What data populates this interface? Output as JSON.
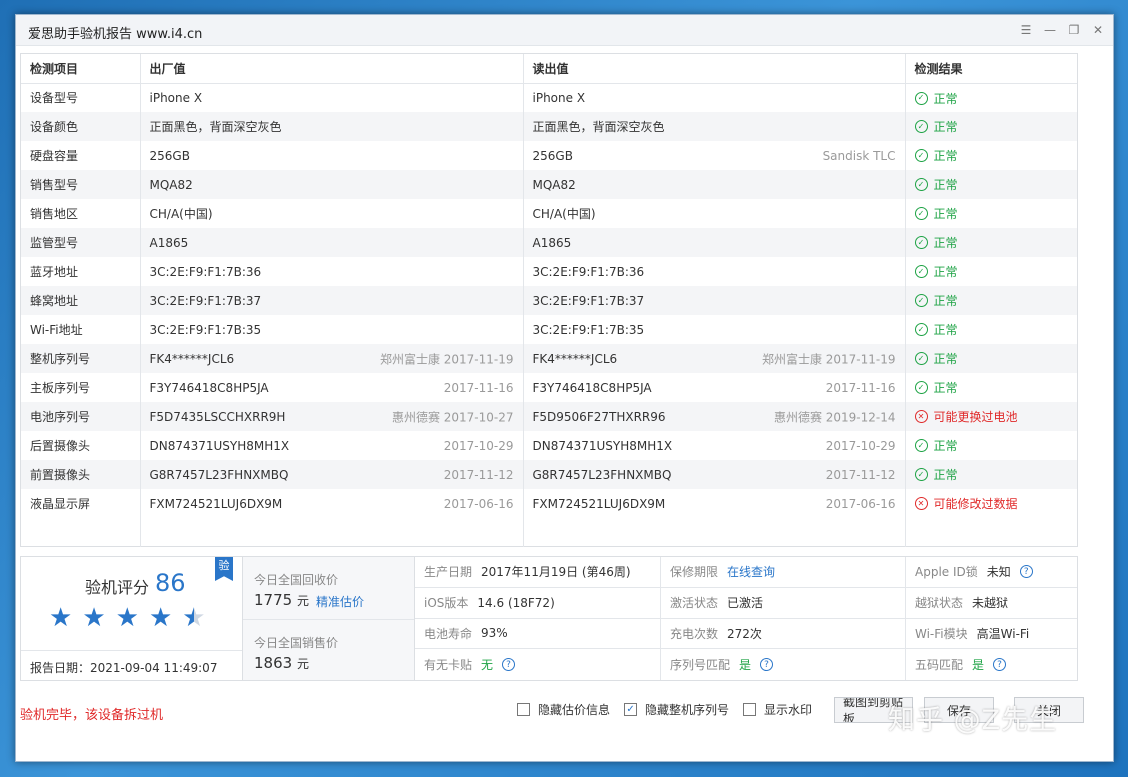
{
  "window": {
    "title": "爱思助手验机报告 www.i4.cn"
  },
  "table": {
    "headers": [
      "检测项目",
      "出厂值",
      "读出值",
      "检测结果"
    ],
    "rows": [
      {
        "item": "设备型号",
        "factory": "iPhone X",
        "factory_extra": "",
        "read": "iPhone X",
        "read_extra": "",
        "result": "正常",
        "ok": true
      },
      {
        "item": "设备颜色",
        "factory": "正面黑色，背面深空灰色",
        "factory_extra": "",
        "read": "正面黑色，背面深空灰色",
        "read_extra": "",
        "result": "正常",
        "ok": true
      },
      {
        "item": "硬盘容量",
        "factory": "256GB",
        "factory_extra": "",
        "read": "256GB",
        "read_extra": "Sandisk TLC",
        "result": "正常",
        "ok": true
      },
      {
        "item": "销售型号",
        "factory": "MQA82",
        "factory_extra": "",
        "read": "MQA82",
        "read_extra": "",
        "result": "正常",
        "ok": true
      },
      {
        "item": "销售地区",
        "factory": "CH/A(中国)",
        "factory_extra": "",
        "read": "CH/A(中国)",
        "read_extra": "",
        "result": "正常",
        "ok": true
      },
      {
        "item": "监管型号",
        "factory": "A1865",
        "factory_extra": "",
        "read": "A1865",
        "read_extra": "",
        "result": "正常",
        "ok": true
      },
      {
        "item": "蓝牙地址",
        "factory": "3C:2E:F9:F1:7B:36",
        "factory_extra": "",
        "read": "3C:2E:F9:F1:7B:36",
        "read_extra": "",
        "result": "正常",
        "ok": true
      },
      {
        "item": "蜂窝地址",
        "factory": "3C:2E:F9:F1:7B:37",
        "factory_extra": "",
        "read": "3C:2E:F9:F1:7B:37",
        "read_extra": "",
        "result": "正常",
        "ok": true
      },
      {
        "item": "Wi-Fi地址",
        "factory": "3C:2E:F9:F1:7B:35",
        "factory_extra": "",
        "read": "3C:2E:F9:F1:7B:35",
        "read_extra": "",
        "result": "正常",
        "ok": true
      },
      {
        "item": "整机序列号",
        "factory": "FK4******JCL6",
        "factory_extra": "郑州富士康 2017-11-19",
        "read": "FK4******JCL6",
        "read_extra": "郑州富士康 2017-11-19",
        "result": "正常",
        "ok": true
      },
      {
        "item": "主板序列号",
        "factory": "F3Y746418C8HP5JA",
        "factory_extra": "2017-11-16",
        "read": "F3Y746418C8HP5JA",
        "read_extra": "2017-11-16",
        "result": "正常",
        "ok": true
      },
      {
        "item": "电池序列号",
        "factory": "F5D7435LSCCHXRR9H",
        "factory_extra": "惠州德赛 2017-10-27",
        "read": "F5D9506F27THXRR96",
        "read_extra": "惠州德赛 2019-12-14",
        "result": "可能更换过电池",
        "ok": false
      },
      {
        "item": "后置摄像头",
        "factory": "DN874371USYH8MH1X",
        "factory_extra": "2017-10-29",
        "read": "DN874371USYH8MH1X",
        "read_extra": "2017-10-29",
        "result": "正常",
        "ok": true
      },
      {
        "item": "前置摄像头",
        "factory": "G8R7457L23FHNXMBQ",
        "factory_extra": "2017-11-12",
        "read": "G8R7457L23FHNXMBQ",
        "read_extra": "2017-11-12",
        "result": "正常",
        "ok": true
      },
      {
        "item": "液晶显示屏",
        "factory": "FXM724521LUJ6DX9M",
        "factory_extra": "2017-06-16",
        "read": "FXM724521LUJ6DX9M",
        "read_extra": "2017-06-16",
        "result": "可能修改过数据",
        "ok": false
      }
    ]
  },
  "score": {
    "label": "验机评分",
    "value": "86",
    "badge": "验",
    "stars": 4.5,
    "report_date": "报告日期：2021-09-04 11:49:07"
  },
  "prices": {
    "recycle_label": "今日全国回收价",
    "recycle_value": "1775",
    "recycle_unit": "元",
    "recycle_link": "精准估价",
    "sale_label": "今日全国销售价",
    "sale_value": "1863",
    "sale_unit": "元"
  },
  "info": [
    {
      "k": "生产日期",
      "v": "2017年11月19日 (第46周)",
      "style": ""
    },
    {
      "k": "保修期限",
      "v": "在线查询",
      "style": "link"
    },
    {
      "k": "Apple ID锁",
      "v": "未知",
      "style": "",
      "help": true
    },
    {
      "k": "iOS版本",
      "v": "14.6 (18F72)",
      "style": ""
    },
    {
      "k": "激活状态",
      "v": "已激活",
      "style": ""
    },
    {
      "k": "越狱状态",
      "v": "未越狱",
      "style": ""
    },
    {
      "k": "电池寿命",
      "v": "93%",
      "style": ""
    },
    {
      "k": "充电次数",
      "v": "272次",
      "style": ""
    },
    {
      "k": "Wi-Fi模块",
      "v": "高温Wi-Fi",
      "style": ""
    },
    {
      "k": "有无卡贴",
      "v": "无",
      "style": "green",
      "help": true
    },
    {
      "k": "序列号匹配",
      "v": "是",
      "style": "green",
      "help": true
    },
    {
      "k": "五码匹配",
      "v": "是",
      "style": "green",
      "help": true
    }
  ],
  "footer": {
    "message": "验机完毕，该设备拆过机",
    "options": [
      {
        "label": "隐藏估价信息",
        "checked": false
      },
      {
        "label": "隐藏整机序列号",
        "checked": true
      },
      {
        "label": "显示水印",
        "checked": false
      }
    ],
    "screenshot_button": "截图到剪贴板",
    "save_button": "保存",
    "close_button": "关闭"
  },
  "watermark": "知乎 @Z先生",
  "colors": {
    "accent": "#2a76c9",
    "ok": "#1ea345",
    "bad": "#e02a2a"
  }
}
